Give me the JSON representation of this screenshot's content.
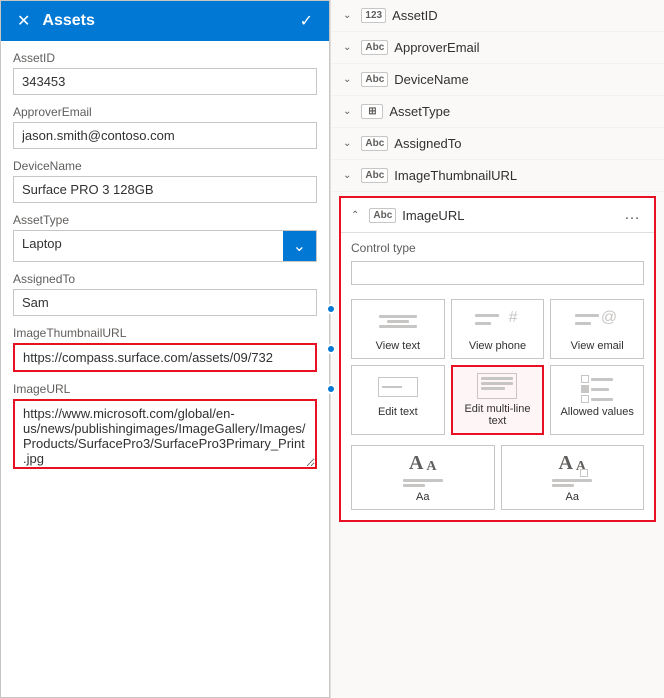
{
  "header": {
    "title": "Assets",
    "close_label": "✕",
    "check_label": "✓"
  },
  "fields": [
    {
      "id": "assetid",
      "label": "AssetID",
      "value": "343453",
      "type": "text",
      "highlighted": false
    },
    {
      "id": "approveremail",
      "label": "ApproverEmail",
      "value": "jason.smith@contoso.com",
      "type": "text",
      "highlighted": false
    },
    {
      "id": "devicename",
      "label": "DeviceName",
      "value": "Surface PRO 3 128GB",
      "type": "text",
      "highlighted": false
    },
    {
      "id": "assettype",
      "label": "AssetType",
      "value": "Laptop",
      "type": "dropdown",
      "highlighted": false
    },
    {
      "id": "assignedto",
      "label": "AssignedTo",
      "value": "Sam",
      "type": "text",
      "highlighted": false
    },
    {
      "id": "imagethumbnailurl",
      "label": "ImageThumbnailURL",
      "value": "https://compass.surface.com/assets/09/732",
      "type": "text",
      "highlighted": true
    },
    {
      "id": "imageurl",
      "label": "ImageURL",
      "value": "https://www.microsoft.com/global/en-us/news/publishingimages/ImageGallery/Images/Products/SurfacePro3/SurfacePro3Primary_Print.jpg",
      "type": "textarea",
      "highlighted": true
    }
  ],
  "right_panel": {
    "field_list": [
      {
        "id": "assetid",
        "label": "AssetID",
        "badge": "123",
        "collapsed": true
      },
      {
        "id": "approveremail",
        "label": "ApproverEmail",
        "badge": "Abc",
        "collapsed": true
      },
      {
        "id": "devicename",
        "label": "DeviceName",
        "badge": "Abc",
        "collapsed": true
      },
      {
        "id": "assettype",
        "label": "AssetType",
        "badge": "⊞",
        "collapsed": true
      },
      {
        "id": "assignedto",
        "label": "AssignedTo",
        "badge": "Abc",
        "collapsed": true
      },
      {
        "id": "imagethumbnailurl",
        "label": "ImageThumbnailURL",
        "badge": "Abc",
        "collapsed": true
      }
    ],
    "expanded_field": {
      "label": "ImageURL",
      "badge": "Abc",
      "control_type_label": "Control type",
      "control_type_value": ""
    },
    "controls": [
      {
        "id": "view-text",
        "label": "View text",
        "type": "view-text",
        "selected": false
      },
      {
        "id": "view-phone",
        "label": "View phone",
        "type": "view-phone",
        "selected": false
      },
      {
        "id": "view-email",
        "label": "View email",
        "type": "view-email",
        "selected": false
      },
      {
        "id": "edit-text",
        "label": "Edit text",
        "type": "edit-text",
        "selected": false
      },
      {
        "id": "edit-multiline",
        "label": "Edit multi-line text",
        "type": "edit-multiline",
        "selected": true
      },
      {
        "id": "allowed-values",
        "label": "Allowed values",
        "type": "allowed-values",
        "selected": false
      }
    ],
    "font_controls": [
      {
        "id": "font-1",
        "label": "Aa",
        "type": "font-1"
      },
      {
        "id": "font-2",
        "label": "Aa",
        "type": "font-2"
      }
    ]
  }
}
